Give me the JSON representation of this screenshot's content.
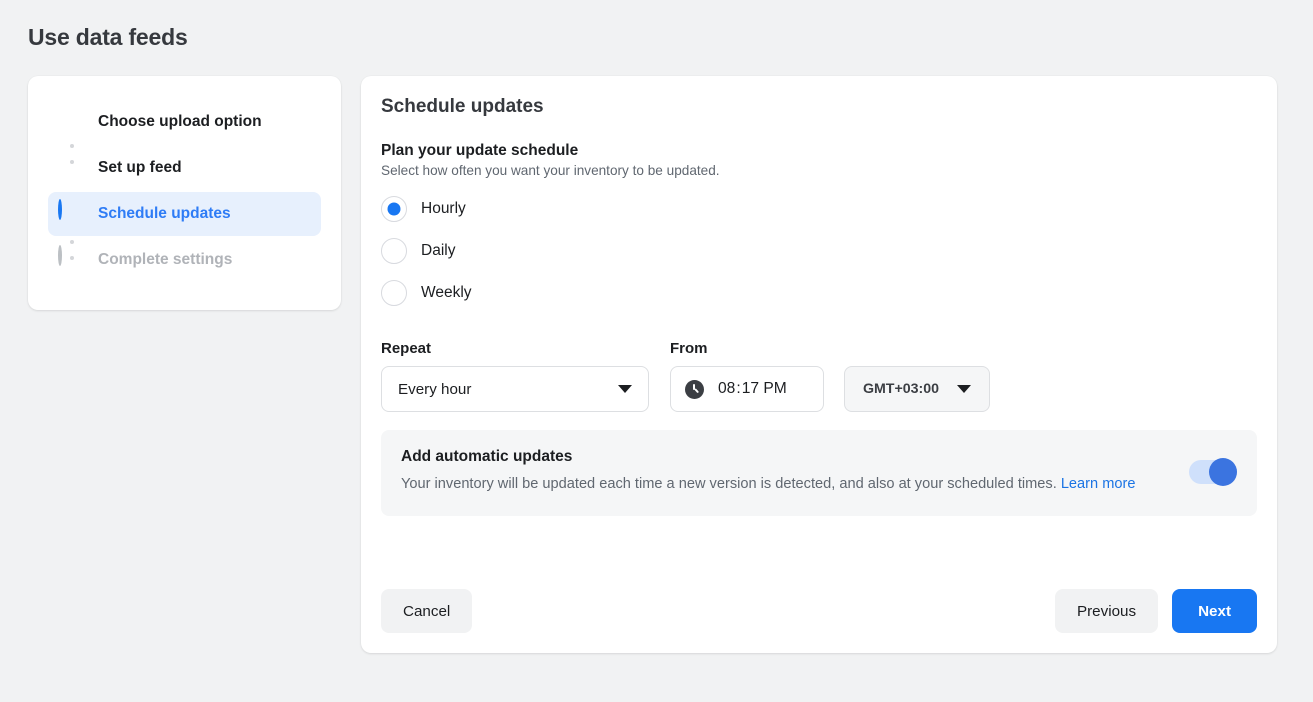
{
  "page": {
    "title": "Use data feeds"
  },
  "stepper": {
    "steps": [
      {
        "label": "Choose upload option",
        "state": "done",
        "icon": "check-circle-icon"
      },
      {
        "label": "Set up feed",
        "state": "done",
        "icon": "check-circle-icon"
      },
      {
        "label": "Schedule updates",
        "state": "active",
        "icon": "half-circle-icon"
      },
      {
        "label": "Complete settings",
        "state": "upcoming",
        "icon": "empty-circle-icon"
      }
    ]
  },
  "panel": {
    "title": "Schedule updates",
    "plan": {
      "heading": "Plan your update schedule",
      "subtext": "Select how often you want your inventory to be updated.",
      "options": [
        {
          "label": "Hourly",
          "selected": true
        },
        {
          "label": "Daily",
          "selected": false
        },
        {
          "label": "Weekly",
          "selected": false
        }
      ]
    },
    "fields": {
      "repeat_label": "Repeat",
      "repeat_value": "Every hour",
      "from_label": "From",
      "time_hour": "08",
      "time_separator": ":",
      "time_minute": "17",
      "time_meridiem": "PM",
      "timezone_value": "GMT+03:00"
    },
    "auto_updates": {
      "title": "Add automatic updates",
      "description": "Your inventory will be updated each time a new version is detected, and also at your scheduled times.",
      "link_label": "Learn more",
      "toggle_on": true
    },
    "footer": {
      "cancel_label": "Cancel",
      "previous_label": "Previous",
      "next_label": "Next"
    }
  },
  "colors": {
    "accent": "#1877f2",
    "success": "#42b72a",
    "link": "#1b74e4",
    "active_row_bg": "#e7f0fd",
    "page_bg": "#f1f2f3"
  }
}
